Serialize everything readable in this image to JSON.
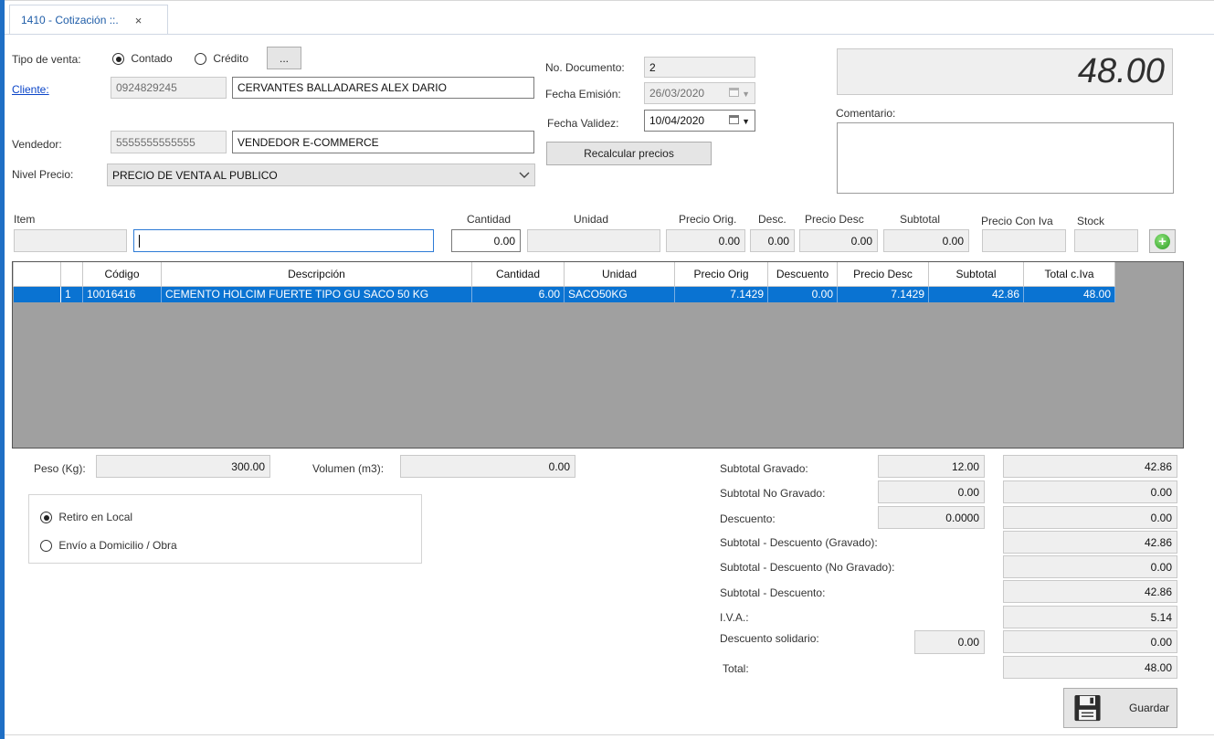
{
  "tab": {
    "title": "1410 - Cotización ::.",
    "close": "×"
  },
  "header": {
    "tipo_venta_label": "Tipo de venta:",
    "contado_label": "Contado",
    "credito_label": "Crédito",
    "tipo_venta_selected": "Contado",
    "ellipsis_label": "...",
    "cliente_label": "Cliente:",
    "cliente_id": "0924829245",
    "cliente_name": "CERVANTES BALLADARES ALEX DARIO",
    "vendedor_label": "Vendedor:",
    "vendedor_id": "5555555555555",
    "vendedor_name": "VENDEDOR E-COMMERCE",
    "nivel_precio_label": "Nivel Precio:",
    "nivel_precio_value": "PRECIO DE VENTA AL PUBLICO",
    "no_documento_label": "No. Documento:",
    "no_documento_value": "2",
    "fecha_emision_label": "Fecha Emisión:",
    "fecha_emision_value": "26/03/2020",
    "fecha_validez_label": "Fecha Validez:",
    "fecha_validez_value": "10/04/2020",
    "recalcular_label": "Recalcular precios",
    "total_display": "48.00",
    "comentario_label": "Comentario:",
    "comentario_value": ""
  },
  "item_entry": {
    "item_label": "Item",
    "cantidad_label": "Cantidad",
    "unidad_label": "Unidad",
    "precio_orig_label": "Precio Orig.",
    "desc_label": "Desc.",
    "precio_desc_label": "Precio Desc",
    "subtotal_label": "Subtotal",
    "precio_con_iva_label": "Precio Con Iva",
    "stock_label": "Stock",
    "item_code": "",
    "item_search": "",
    "cantidad": "0.00",
    "unidad": "",
    "precio_orig": "0.00",
    "desc": "0.00",
    "precio_desc": "0.00",
    "subtotal": "0.00",
    "precio_con_iva": "",
    "stock": ""
  },
  "grid": {
    "columns": [
      "",
      "Código",
      "Descripción",
      "Cantidad",
      "Unidad",
      "Precio Orig",
      "Descuento",
      "Precio Desc",
      "Subtotal",
      "Total c.Iva"
    ],
    "rows": [
      [
        "1",
        "10016416",
        "CEMENTO HOLCIM FUERTE TIPO GU SACO 50 KG",
        "6.00",
        "SACO50KG",
        "7.1429",
        "0.00",
        "7.1429",
        "42.86",
        "48.00"
      ]
    ]
  },
  "footer": {
    "peso_label": "Peso (Kg):",
    "peso_value": "300.00",
    "volumen_label": "Volumen (m3):",
    "volumen_value": "0.00",
    "retiro_label": "Retiro en Local",
    "envio_label": "Envío a Domicilio / Obra",
    "entrega_selected": "Retiro en Local"
  },
  "totals": {
    "subtotal_gravado_label": "Subtotal Gravado:",
    "subtotal_gravado_pct": "12.00",
    "subtotal_gravado": "42.86",
    "subtotal_no_gravado_label": "Subtotal No Gravado:",
    "subtotal_no_gravado_pct": "0.00",
    "subtotal_no_gravado": "0.00",
    "descuento_label": "Descuento:",
    "descuento_pct": "0.0000",
    "descuento": "0.00",
    "sub_desc_gravado_label": "Subtotal - Descuento (Gravado):",
    "sub_desc_gravado": "42.86",
    "sub_desc_no_gravado_label": "Subtotal - Descuento (No Gravado):",
    "sub_desc_no_gravado": "0.00",
    "sub_desc_label": "Subtotal - Descuento:",
    "sub_desc": "42.86",
    "iva_label": "I.V.A.:",
    "iva": "5.14",
    "desc_solidario_label": "Descuento solidario:",
    "desc_solidario_pct": "0.00",
    "desc_solidario": "0.00",
    "total_label": "Total:",
    "total": "48.00"
  },
  "actions": {
    "guardar_label": "Guardar"
  }
}
